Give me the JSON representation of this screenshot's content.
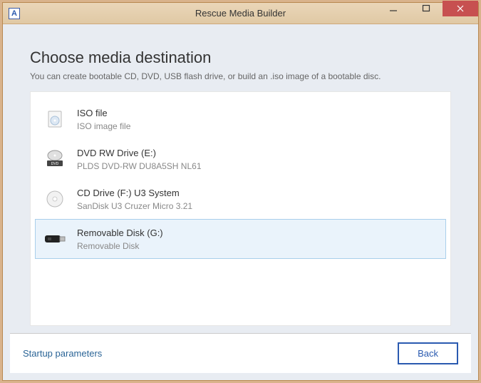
{
  "window": {
    "title": "Rescue Media Builder"
  },
  "page": {
    "heading": "Choose media destination",
    "subtitle": "You can create bootable CD, DVD, USB flash drive, or build an .iso image of a bootable disc."
  },
  "options": [
    {
      "icon": "iso-icon",
      "title": "ISO file",
      "subtitle": "ISO image file",
      "selected": false
    },
    {
      "icon": "dvd-drive-icon",
      "title": "DVD RW Drive (E:)",
      "subtitle": "PLDS DVD-RW DU8A5SH NL61",
      "selected": false
    },
    {
      "icon": "cd-icon",
      "title": "CD Drive (F:) U3 System",
      "subtitle": "SanDisk U3 Cruzer Micro 3.21",
      "selected": false
    },
    {
      "icon": "usb-icon",
      "title": "Removable Disk (G:)",
      "subtitle": "Removable Disk",
      "selected": true
    }
  ],
  "footer": {
    "link": "Startup parameters",
    "backButton": "Back"
  }
}
